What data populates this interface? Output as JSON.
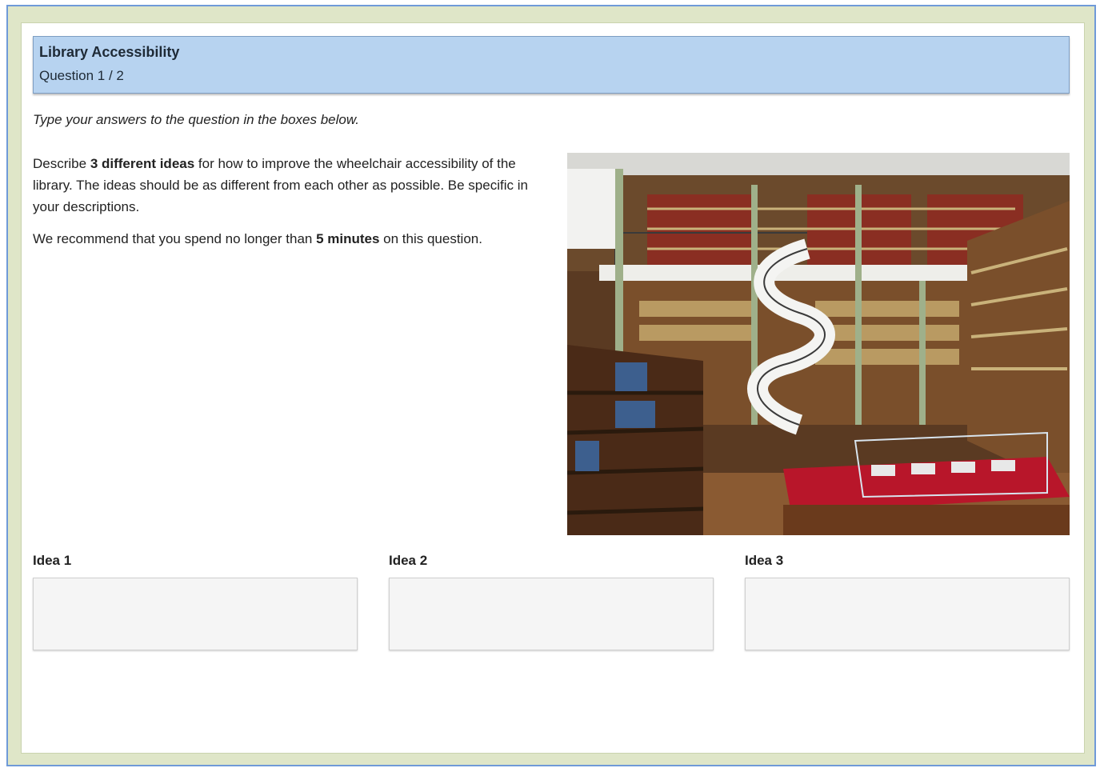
{
  "header": {
    "title": "Library Accessibility",
    "question_counter": "Question 1 / 2"
  },
  "instruction": "Type your answers to the question in the boxes below.",
  "prompt": {
    "p1_before": "Describe ",
    "p1_bold": "3 different ideas",
    "p1_after": " for how to improve the wheelchair accessibility of the library. The ideas should be as different from each other as possible. Be specific in your descriptions.",
    "p2_before": "We recommend that you spend no longer than ",
    "p2_bold": "5 minutes",
    "p2_after": " on this question."
  },
  "ideas": [
    {
      "label": "Idea 1",
      "value": ""
    },
    {
      "label": "Idea 2",
      "value": ""
    },
    {
      "label": "Idea 3",
      "value": ""
    }
  ],
  "colors": {
    "frame_border": "#6f9ad8",
    "frame_fill": "#dfe6c8",
    "header_fill": "#b7d3f0",
    "input_fill": "#f5f5f5"
  }
}
